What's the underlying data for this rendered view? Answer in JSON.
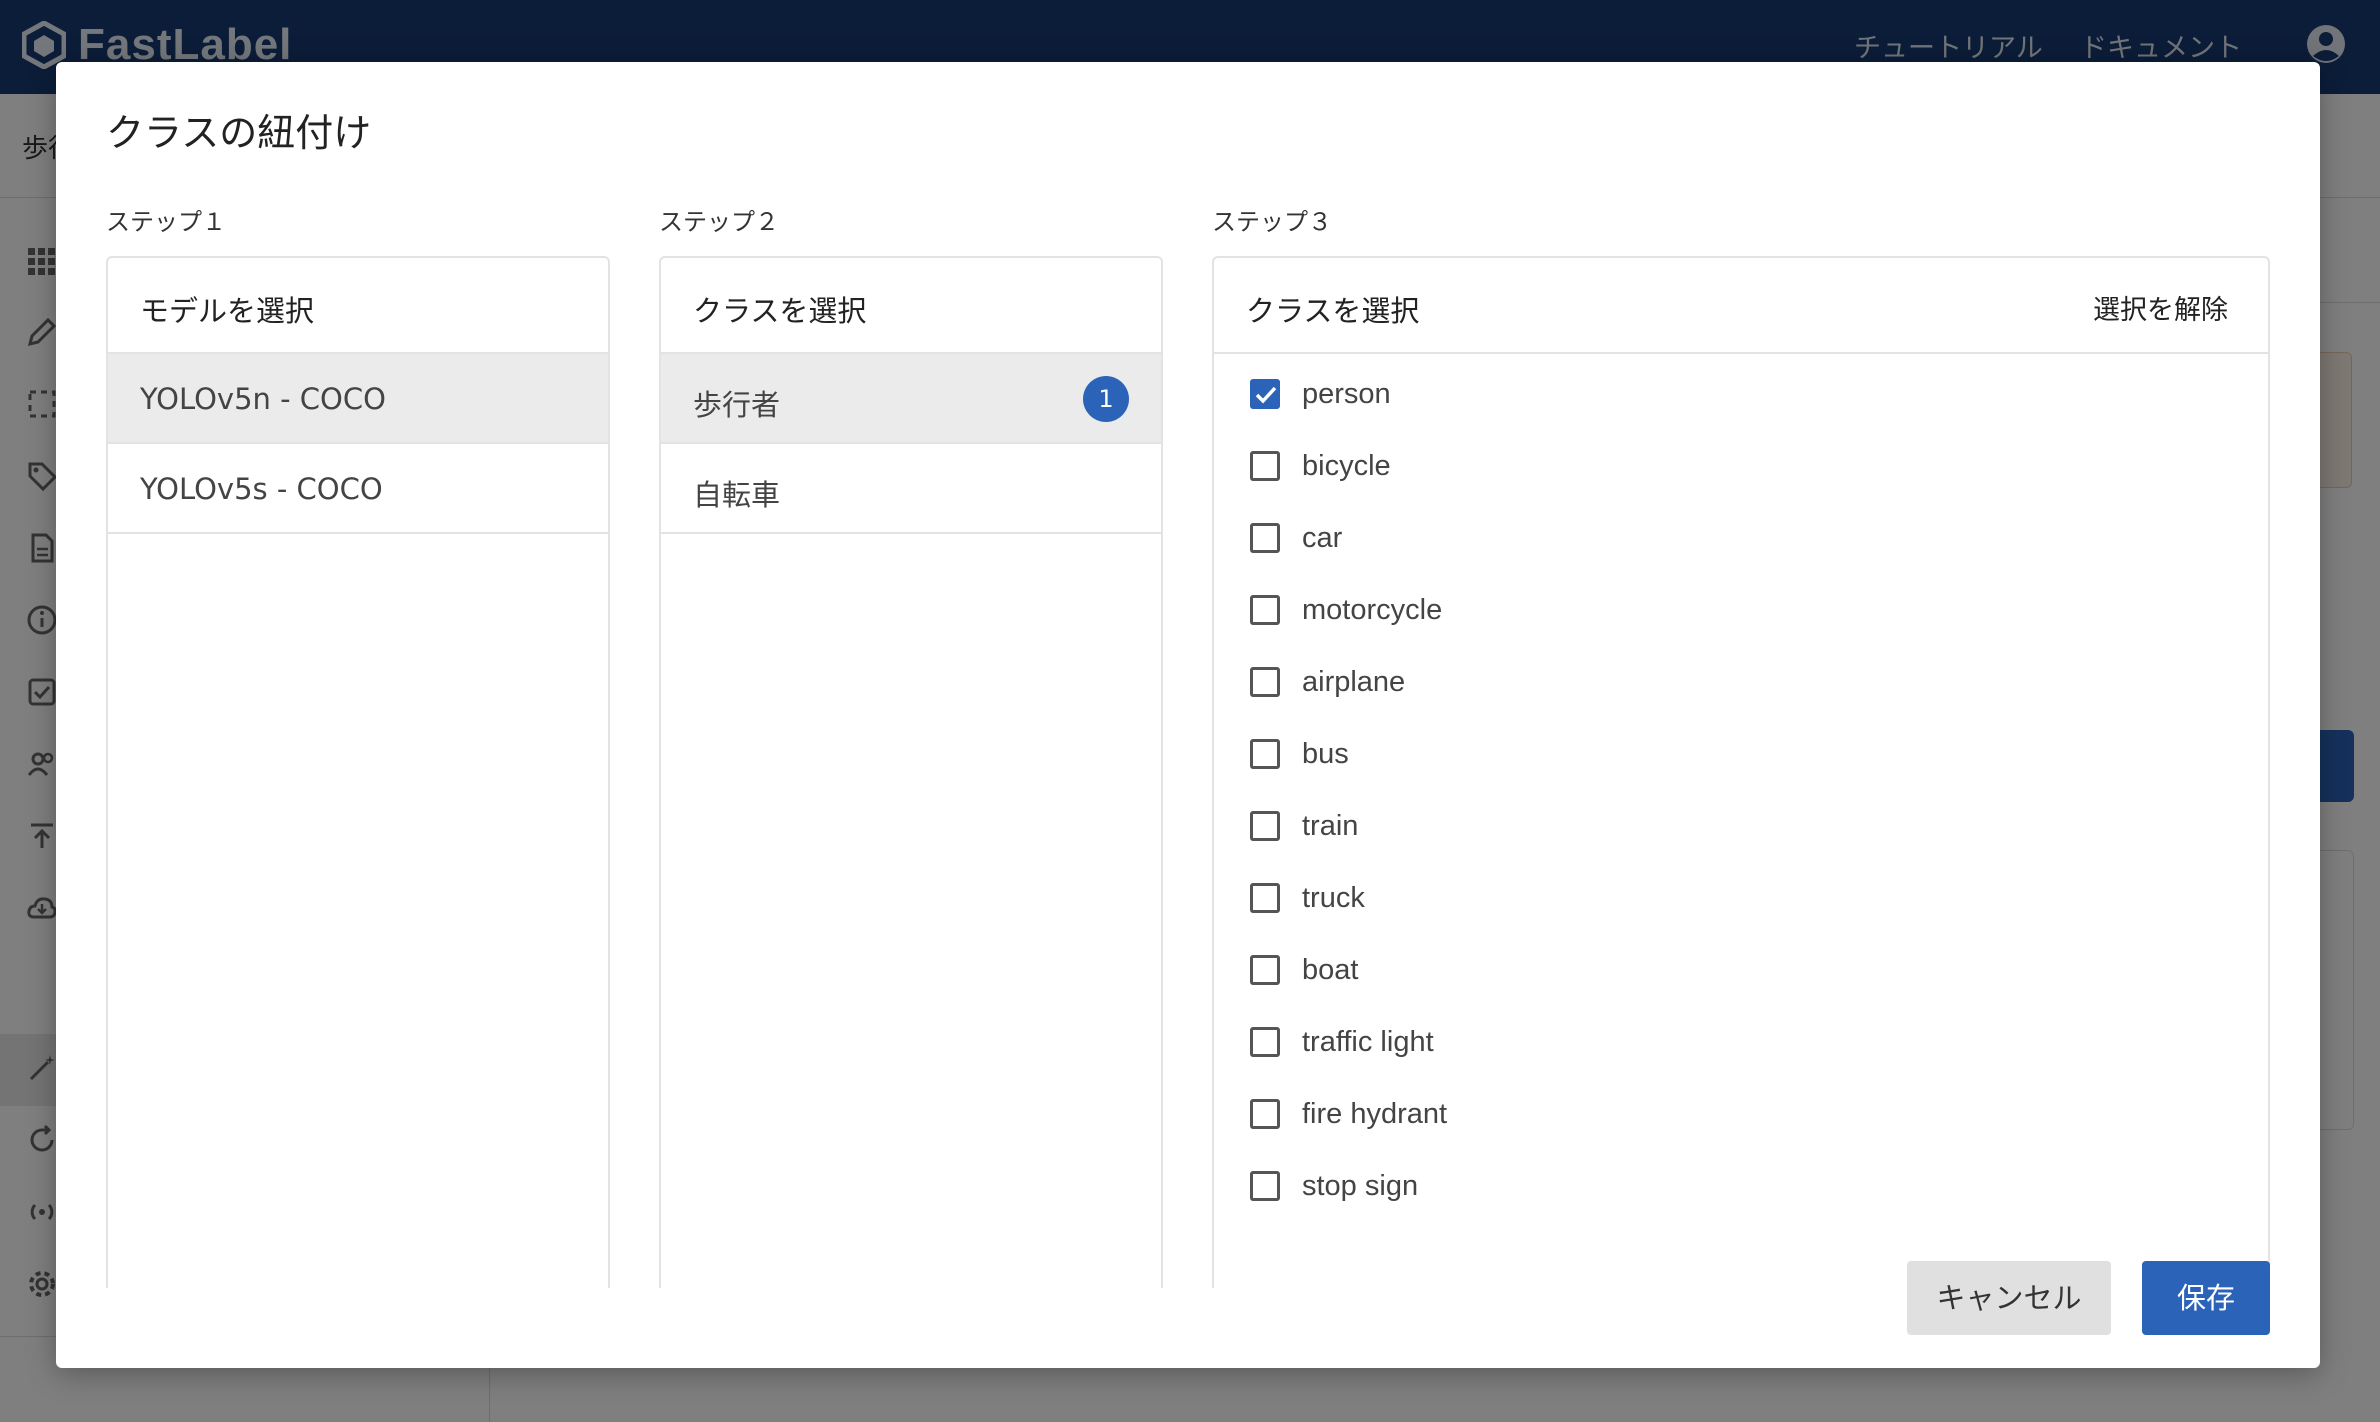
{
  "app": {
    "logo_text": "FastLabel",
    "nav_links": [
      "チュートリアル",
      "ドキュメント"
    ],
    "subbar_text": "歩行"
  },
  "modal": {
    "title": "クラスの紐付け",
    "steps": [
      {
        "label": "ステップ１",
        "panel_title": "モデルを選択",
        "items": [
          {
            "text": "YOLOv5n - COCO",
            "selected": true
          },
          {
            "text": "YOLOv5s - COCO",
            "selected": false
          }
        ]
      },
      {
        "label": "ステップ２",
        "panel_title": "クラスを選択",
        "items": [
          {
            "text": "歩行者",
            "selected": true,
            "badge": "1"
          },
          {
            "text": "自転車",
            "selected": false
          }
        ]
      },
      {
        "label": "ステップ３",
        "panel_title": "クラスを選択",
        "action": "選択を解除",
        "classes": [
          {
            "label": "person",
            "checked": true
          },
          {
            "label": "bicycle",
            "checked": false
          },
          {
            "label": "car",
            "checked": false
          },
          {
            "label": "motorcycle",
            "checked": false
          },
          {
            "label": "airplane",
            "checked": false
          },
          {
            "label": "bus",
            "checked": false
          },
          {
            "label": "train",
            "checked": false
          },
          {
            "label": "truck",
            "checked": false
          },
          {
            "label": "boat",
            "checked": false
          },
          {
            "label": "traffic light",
            "checked": false
          },
          {
            "label": "fire hydrant",
            "checked": false
          },
          {
            "label": "stop sign",
            "checked": false
          }
        ]
      }
    ],
    "buttons": {
      "cancel_label": "キャンセル",
      "save_label": "保存"
    }
  },
  "colors": {
    "header_bg": "#183b73",
    "primary": "#2a63b8"
  }
}
